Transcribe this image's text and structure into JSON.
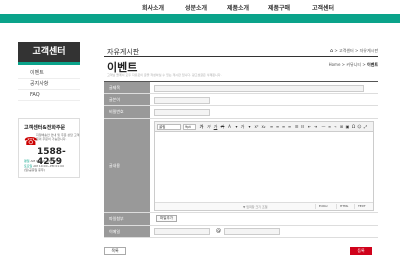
{
  "nav": {
    "items": [
      "회사소개",
      "성분소개",
      "제품소개",
      "제품구매",
      "고객센터"
    ]
  },
  "sidebar": {
    "title": "고객센터",
    "items": [
      "이벤트",
      "공지사항",
      "FAQ"
    ],
    "support": {
      "heading": "고객센터&전화주문",
      "description": "지정배송안 안내 및 주문 상담 고객문의 주문이 가능합니다.",
      "phone": "1588-4259",
      "hours": [
        {
          "label": "평일",
          "value": "AM 09:00~PM 06:00"
        },
        {
          "label": "토요일",
          "value": "AM 10:00~PM 01:00"
        },
        {
          "label": "",
          "value": "(일/공휴일 휴무)"
        }
      ]
    }
  },
  "header": {
    "board_title": "자유게시판",
    "breadcrumb": [
      "고객센터",
      "자유게시판"
    ],
    "page_title": "이벤트",
    "breadcrumb2": [
      "Home",
      "커뮤니티",
      "이벤트"
    ],
    "description": "고객님 들께서 모두 자유로이 글을 작성하실 수 있는 게시판 입니다. 광고성글은 삭제됩니다."
  },
  "form": {
    "labels": {
      "title": "글제목",
      "writer": "글쓴이",
      "password": "비밀번호",
      "content": "글내용",
      "attachment": "파일첨부",
      "email": "이메일"
    },
    "toolbar": {
      "font_select": "굴림",
      "size_select": "9pt"
    },
    "editor_footer": {
      "resize_hint": "▼ 입력창 크기 조절",
      "modes": [
        "Editor",
        "HTML",
        "TEXT"
      ]
    },
    "attach_button": "파일추가",
    "email_at": "@"
  },
  "buttons": {
    "list": "목록",
    "submit": "등록"
  },
  "colors": {
    "accent": "#0aa38a",
    "label_bg": "#999999",
    "submit": "#d0021b"
  }
}
